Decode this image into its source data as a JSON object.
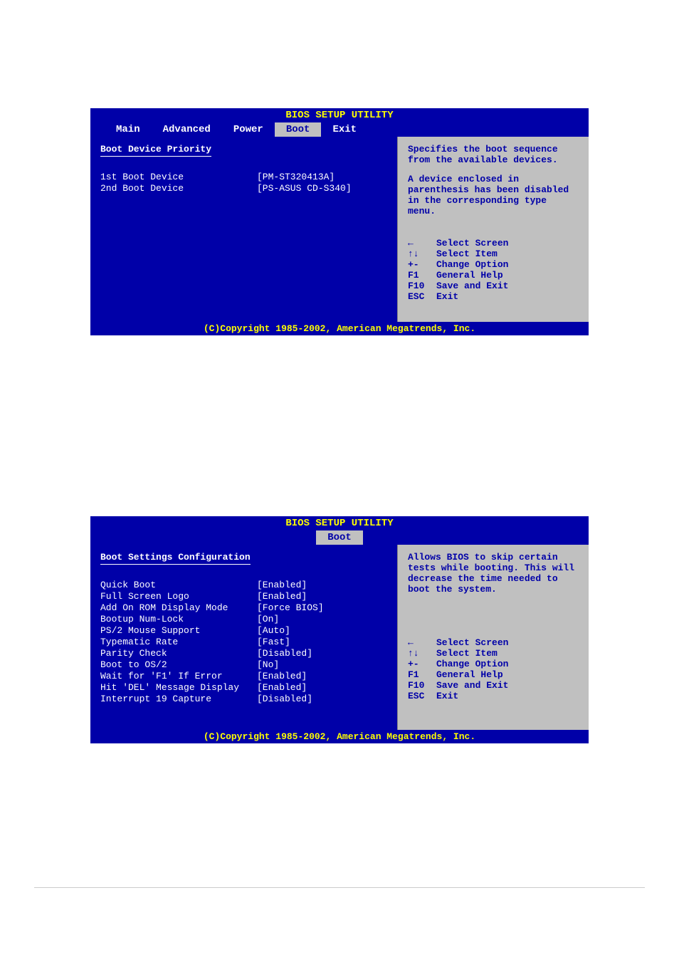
{
  "screen1": {
    "title": "BIOS SETUP UTILITY",
    "tabs": [
      "Main",
      "Advanced",
      "Power",
      "Boot",
      "Exit"
    ],
    "selectedTab": "Boot",
    "sectionTitle": "Boot Device Priority",
    "settings": [
      {
        "label": "1st Boot Device",
        "value": "[PM-ST320413A]"
      },
      {
        "label": "2nd Boot Device",
        "value": "[PS-ASUS CD-S340]"
      }
    ],
    "helpText1": "Specifies the boot sequence from the available devices.",
    "helpText2": "A device enclosed in parenthesis has been disabled in the corresponding type menu.",
    "copyright": "(C)Copyright 1985-2002, American Megatrends, Inc."
  },
  "screen2": {
    "title": "BIOS SETUP UTILITY",
    "selectedTab": "Boot",
    "sectionTitle": "Boot Settings Configuration",
    "settings": [
      {
        "label": "Quick Boot",
        "value": "[Enabled]",
        "highlight": true
      },
      {
        "label": "Full Screen Logo",
        "value": "[Enabled]"
      },
      {
        "label": "Add On ROM Display Mode",
        "value": "[Force BIOS]"
      },
      {
        "label": "Bootup Num-Lock",
        "value": "[On]"
      },
      {
        "label": "PS/2 Mouse Support",
        "value": "[Auto]"
      },
      {
        "label": "Typematic Rate",
        "value": "[Fast]"
      },
      {
        "label": "Parity Check",
        "value": "[Disabled]"
      },
      {
        "label": "Boot to OS/2",
        "value": "[No]"
      },
      {
        "label": "Wait for 'F1' If Error",
        "value": "[Enabled]"
      },
      {
        "label": "Hit 'DEL' Message Display",
        "value": "[Enabled]"
      },
      {
        "label": "Interrupt 19 Capture",
        "value": "[Disabled]"
      }
    ],
    "helpText1": "Allows BIOS to skip certain tests while booting. This will decrease the time needed to boot the system.",
    "copyright": "(C)Copyright 1985-2002, American Megatrends, Inc."
  },
  "keyHints": [
    {
      "key": "←",
      "desc": "Select Screen"
    },
    {
      "key": "↑↓",
      "desc": "Select Item"
    },
    {
      "key": "+-",
      "desc": "Change Option"
    },
    {
      "key": "F1",
      "desc": "General Help"
    },
    {
      "key": "F10",
      "desc": "Save and Exit"
    },
    {
      "key": "ESC",
      "desc": "Exit"
    }
  ]
}
